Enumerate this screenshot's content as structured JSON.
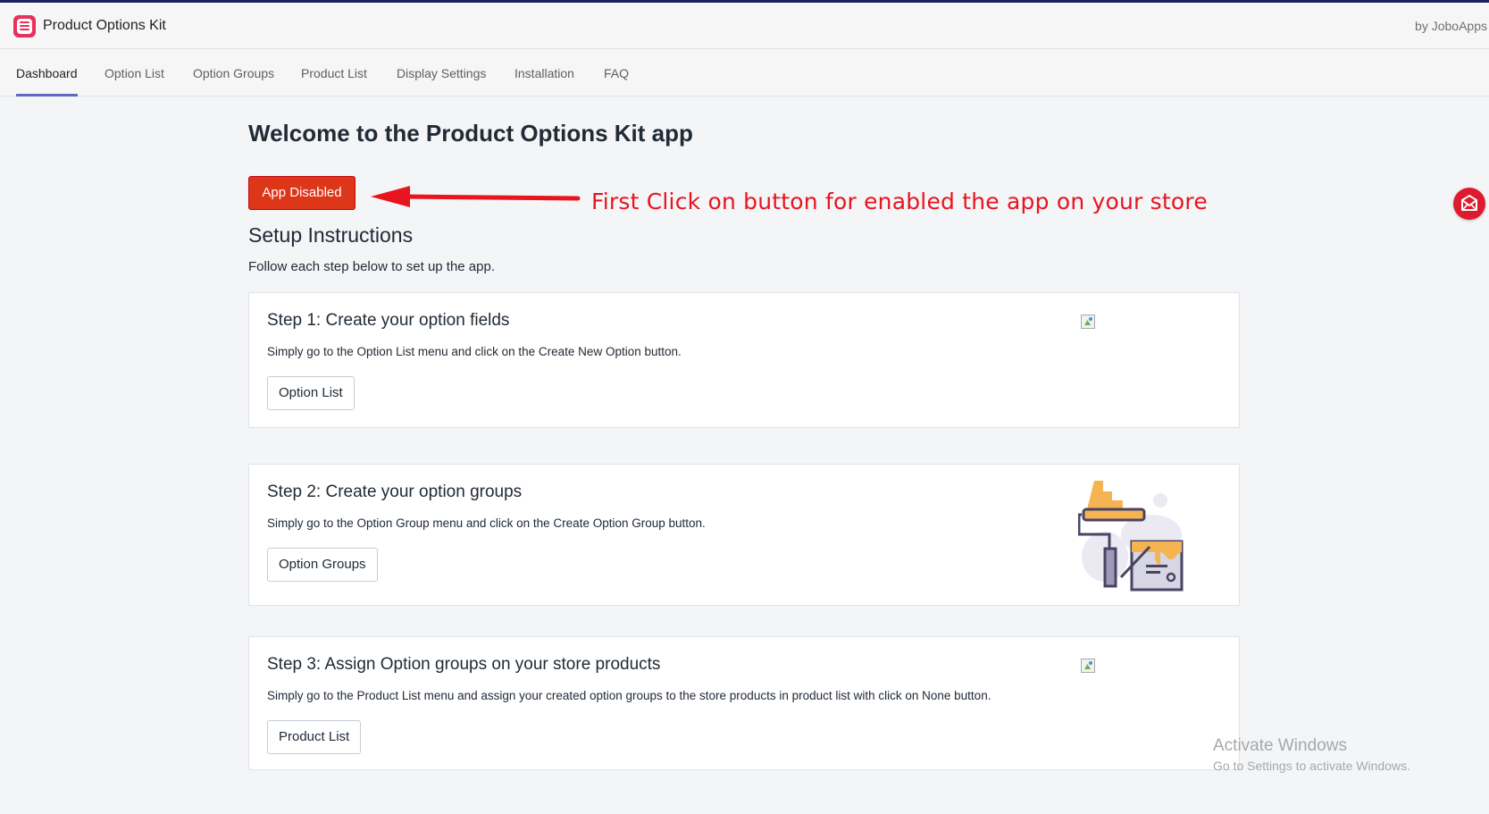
{
  "header": {
    "app_title": "Product Options Kit",
    "vendor": "by JoboApps",
    "logo_icon": "list-icon",
    "brand_color": "#e8305d"
  },
  "nav": {
    "tabs": [
      {
        "label": "Dashboard",
        "active": true
      },
      {
        "label": "Option List",
        "active": false
      },
      {
        "label": "Option Groups",
        "active": false
      },
      {
        "label": "Product List",
        "active": false
      },
      {
        "label": "Display Settings",
        "active": false
      },
      {
        "label": "Installation",
        "active": false
      },
      {
        "label": "FAQ",
        "active": false
      }
    ],
    "active_color": "#5c6ac4"
  },
  "main": {
    "welcome": "Welcome to the Product Options Kit app",
    "status_button": "App Disabled",
    "status_color": "#de3618",
    "annotation": "First Click on button for enabled the app on your store",
    "annotation_color": "#e8141f",
    "setup_title": "Setup Instructions",
    "setup_subtitle": "Follow each step below to set up the app.",
    "steps": [
      {
        "title": "Step 1: Create your option fields",
        "description": "Simply go to the Option List menu and click on the Create New Option button.",
        "button": "Option List",
        "image": "broken-image-icon"
      },
      {
        "title": "Step 2: Create your option groups",
        "description": "Simply go to the Option Group menu and click on the Create Option Group button.",
        "button": "Option Groups",
        "image": "paint-roller-illustration"
      },
      {
        "title": "Step 3: Assign Option groups on your store products",
        "description": "Simply go to the Product List menu and assign your created option groups to the store products in product list with click on None button.",
        "button": "Product List",
        "image": "broken-image-icon"
      }
    ]
  },
  "floating": {
    "mail_icon": "mail-icon",
    "color": "#de1b2e"
  },
  "watermark": {
    "line1": "Activate Windows",
    "line2": "Go to Settings to activate Windows."
  }
}
